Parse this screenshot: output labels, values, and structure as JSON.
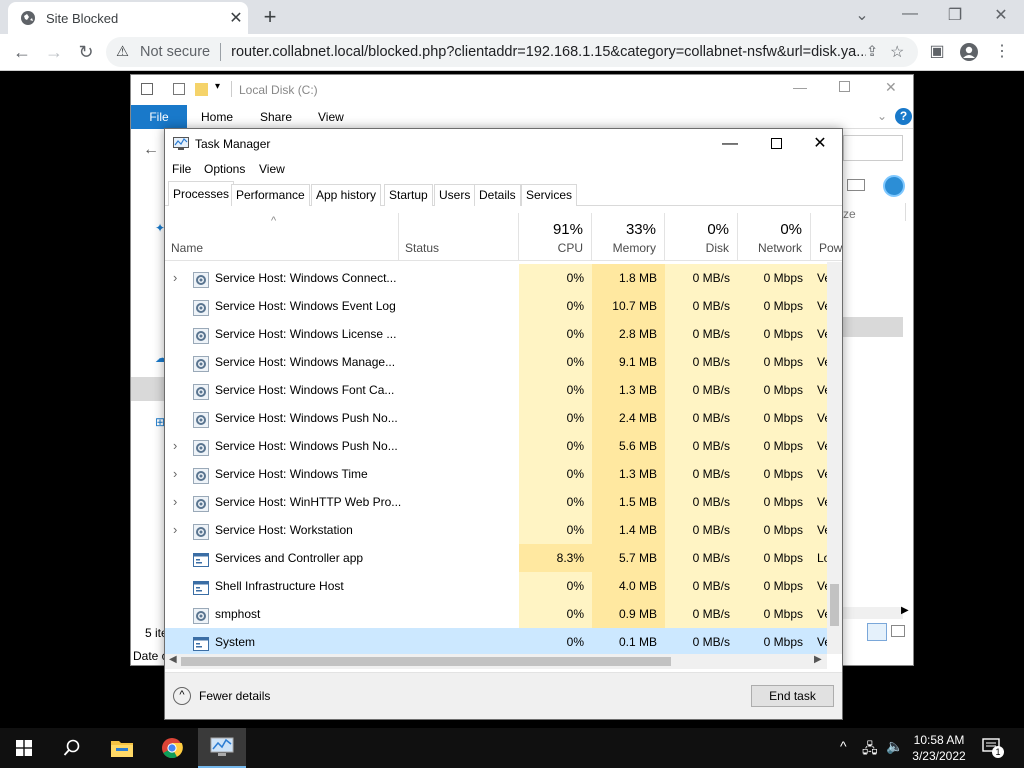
{
  "browser": {
    "tab_title": "Site Blocked",
    "new_tab": "+",
    "security_label": "Not secure",
    "url": "router.collabnet.local/blocked.php?clientaddr=192.168.1.15&category=collabnet-nsfw&url=disk.ya..."
  },
  "explorer": {
    "title": "Local Disk (C:)",
    "ribbon": {
      "file": "File",
      "home": "Home",
      "share": "Share",
      "view": "View"
    },
    "status_items": "5 ite",
    "status_date": "Date c"
  },
  "taskmgr": {
    "title": "Task Manager",
    "menu": [
      "File",
      "Options",
      "View"
    ],
    "tabs": [
      "Processes",
      "Performance",
      "App history",
      "Startup",
      "Users",
      "Details",
      "Services"
    ],
    "columns": {
      "name": "Name",
      "status": "Status",
      "cpu": {
        "pct": "91%",
        "label": "CPU"
      },
      "memory": {
        "pct": "33%",
        "label": "Memory"
      },
      "disk": {
        "pct": "0%",
        "label": "Disk"
      },
      "network": {
        "pct": "0%",
        "label": "Network"
      },
      "power": "Pow"
    },
    "rows": [
      {
        "name": "Service Host: Windows Connect...",
        "cpu": "0%",
        "mem": "1.8 MB",
        "disk": "0 MB/s",
        "net": "0 Mbps",
        "pow": "Ve",
        "expand": true,
        "icon": "gear"
      },
      {
        "name": "Service Host: Windows Event Log",
        "cpu": "0%",
        "mem": "10.7 MB",
        "disk": "0 MB/s",
        "net": "0 Mbps",
        "pow": "Ve",
        "expand": false,
        "icon": "gear"
      },
      {
        "name": "Service Host: Windows License ...",
        "cpu": "0%",
        "mem": "2.8 MB",
        "disk": "0 MB/s",
        "net": "0 Mbps",
        "pow": "Ve",
        "expand": false,
        "icon": "gear"
      },
      {
        "name": "Service Host: Windows Manage...",
        "cpu": "0%",
        "mem": "9.1 MB",
        "disk": "0 MB/s",
        "net": "0 Mbps",
        "pow": "Ve",
        "expand": false,
        "icon": "gear"
      },
      {
        "name": "Service Host: Windows Font Ca...",
        "cpu": "0%",
        "mem": "1.3 MB",
        "disk": "0 MB/s",
        "net": "0 Mbps",
        "pow": "Ve",
        "expand": false,
        "icon": "gear"
      },
      {
        "name": "Service Host: Windows Push No...",
        "cpu": "0%",
        "mem": "2.4 MB",
        "disk": "0 MB/s",
        "net": "0 Mbps",
        "pow": "Ve",
        "expand": false,
        "icon": "gear"
      },
      {
        "name": "Service Host: Windows Push No...",
        "cpu": "0%",
        "mem": "5.6 MB",
        "disk": "0 MB/s",
        "net": "0 Mbps",
        "pow": "Ve",
        "expand": true,
        "icon": "gear"
      },
      {
        "name": "Service Host: Windows Time",
        "cpu": "0%",
        "mem": "1.3 MB",
        "disk": "0 MB/s",
        "net": "0 Mbps",
        "pow": "Ve",
        "expand": true,
        "icon": "gear"
      },
      {
        "name": "Service Host: WinHTTP Web Pro...",
        "cpu": "0%",
        "mem": "1.5 MB",
        "disk": "0 MB/s",
        "net": "0 Mbps",
        "pow": "Ve",
        "expand": true,
        "icon": "gear"
      },
      {
        "name": "Service Host: Workstation",
        "cpu": "0%",
        "mem": "1.4 MB",
        "disk": "0 MB/s",
        "net": "0 Mbps",
        "pow": "Ve",
        "expand": true,
        "icon": "gear"
      },
      {
        "name": "Services and Controller app",
        "cpu": "8.3%",
        "mem": "5.7 MB",
        "disk": "0 MB/s",
        "net": "0 Mbps",
        "pow": "Lo",
        "expand": false,
        "icon": "window"
      },
      {
        "name": "Shell Infrastructure Host",
        "cpu": "0%",
        "mem": "4.0 MB",
        "disk": "0 MB/s",
        "net": "0 Mbps",
        "pow": "Ve",
        "expand": false,
        "icon": "window"
      },
      {
        "name": "smphost",
        "cpu": "0%",
        "mem": "0.9 MB",
        "disk": "0 MB/s",
        "net": "0 Mbps",
        "pow": "Ve",
        "expand": false,
        "icon": "gear"
      },
      {
        "name": "System",
        "cpu": "0%",
        "mem": "0.1 MB",
        "disk": "0 MB/s",
        "net": "0 Mbps",
        "pow": "Ve",
        "expand": false,
        "icon": "window",
        "selected": true
      }
    ],
    "fewer_details": "Fewer details",
    "end_task": "End task"
  },
  "taskbar": {
    "time": "10:58 AM",
    "date": "3/23/2022",
    "notification_count": "1"
  }
}
